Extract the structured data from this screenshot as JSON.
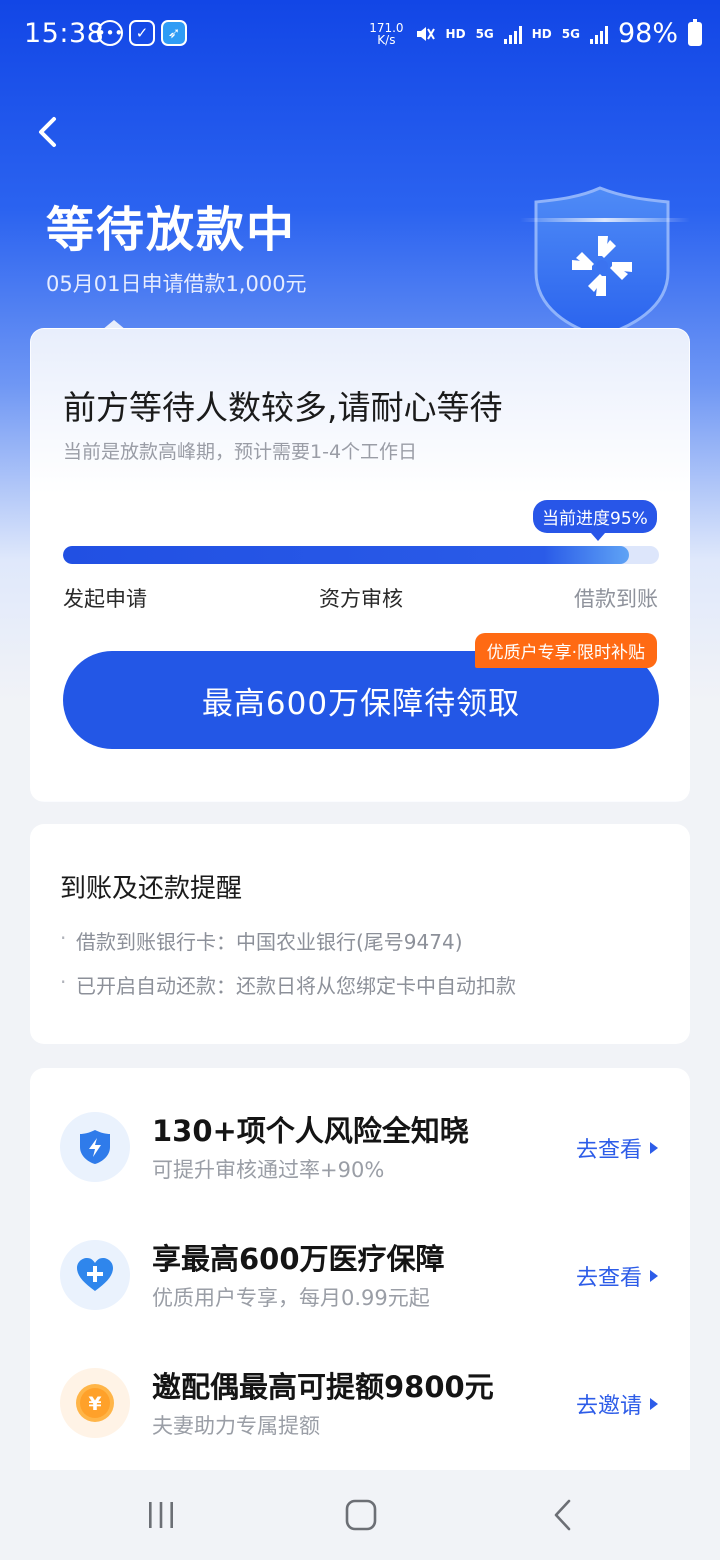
{
  "status_bar": {
    "time": "15:38",
    "net_speed_value": "171.0",
    "net_speed_unit": "K/s",
    "hd_1": "HD",
    "net_1": "5G",
    "hd_2": "HD",
    "net_2": "5G",
    "battery": "98%"
  },
  "header": {
    "title": "等待放款中",
    "subtitle": "05月01日申请借款1,000元"
  },
  "progress_card": {
    "heading": "前方等待人数较多,请耐心等待",
    "subheading": "当前是放款高峰期，预计需要1-4个工作日",
    "badge": "当前进度95%",
    "progress": 0.95,
    "steps": [
      "发起申请",
      "资方审核",
      "借款到账"
    ],
    "promo_tag": "优质户专享·限时补贴",
    "claim_button": "最高600万保障待领取"
  },
  "reminder_card": {
    "title": "到账及还款提醒",
    "items": [
      "借款到账银行卡：中国农业银行(尾号9474)",
      "已开启自动还款：还款日将从您绑定卡中自动扣款"
    ]
  },
  "services": [
    {
      "title": "130+项个人风险全知晓",
      "desc": "可提升审核通过率+90%",
      "action": "去查看",
      "icon": "shield-bolt-icon"
    },
    {
      "title": "享最高600万医疗保障",
      "desc": "优质用户专享，每月0.99元起",
      "action": "去查看",
      "icon": "heart-plus-icon"
    },
    {
      "title": "邀配偶最高可提额9800元",
      "desc": "夫妻助力专属提额",
      "action": "去邀请",
      "icon": "yuan-coin-icon"
    }
  ],
  "colors": {
    "primary": "#2357e6",
    "promo": "#ff6a13",
    "text_dark": "#1b1b1b",
    "text_muted": "#9a9ea6"
  }
}
